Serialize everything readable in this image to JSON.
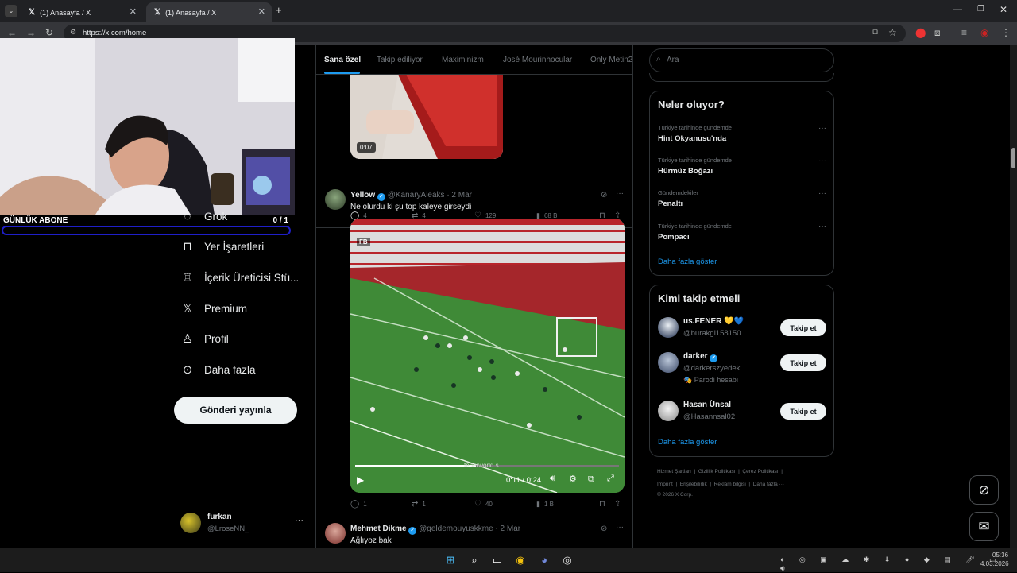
{
  "browser": {
    "tabs": [
      {
        "title": "(1) Anasayfa / X"
      },
      {
        "title": "(1) Anasayfa / X"
      }
    ],
    "url": "https://x.com/home"
  },
  "overlay": {
    "label": "GÜNLÜK ABONE",
    "count": "0 / 1"
  },
  "nav": {
    "items": [
      {
        "label": "Grok",
        "icon": "grok-icon"
      },
      {
        "label": "Yer İşaretleri",
        "icon": "bookmark-icon"
      },
      {
        "label": "İçerik Üreticisi Stü...",
        "icon": "creator-studio-icon"
      },
      {
        "label": "Premium",
        "icon": "x-logo-icon"
      },
      {
        "label": "Profil",
        "icon": "person-icon"
      },
      {
        "label": "Daha fazla",
        "icon": "more-circle-icon"
      }
    ],
    "post_button": "Gönderi yayınla",
    "account": {
      "name": "furkan",
      "handle": "@LroseNN_"
    }
  },
  "feed": {
    "tabs": [
      {
        "label": "Sana özel",
        "active": true
      },
      {
        "label": "Takip ediliyor",
        "active": false
      },
      {
        "label": "Maximinizm",
        "active": false
      },
      {
        "label": "José Mourinhocular",
        "active": false
      },
      {
        "label": "Only Metin2",
        "active": false
      }
    ],
    "tweet1": {
      "video_time": "0:07",
      "replies": "4",
      "reposts": "4",
      "likes": "129",
      "views": "68 B"
    },
    "tweet2": {
      "name": "Yellow",
      "handle": "@KanaryAleaks",
      "date": "· 2 Mar",
      "text": "Ne olurdu ki şu top kaleye girseydi",
      "video_badge": "FB",
      "watermark": "fenerworld.s",
      "video_time": "0:11 / 0:24",
      "replies": "1",
      "reposts": "1",
      "likes": "40",
      "views": "1 B"
    },
    "tweet3": {
      "name": "Mehmet Dikme",
      "handle": "@geldemouyuskkme",
      "date": "· 2 Mar",
      "text": "Ağlıyoz bak"
    }
  },
  "right": {
    "search_placeholder": "Ara",
    "trends_title": "Neler oluyor?",
    "trends": [
      {
        "context": "Türkiye tarihinde gündemde",
        "name": "Hint Okyanusu'nda"
      },
      {
        "context": "Türkiye tarihinde gündemde",
        "name": "Hürmüz Boğazı"
      },
      {
        "context": "Gündemdekiler",
        "name": "Penaltı"
      },
      {
        "context": "Türkiye tarihinde gündemde",
        "name": "Pompacı"
      }
    ],
    "show_more": "Daha fazla göster",
    "who_title": "Kimi takip etmeli",
    "who": [
      {
        "name": "us.FENER 💛💙",
        "handle": "@burakgl158150",
        "extra": ""
      },
      {
        "name": "darker",
        "handle": "@darkerszyedek",
        "extra": "🎭 Parodi hesabı"
      },
      {
        "name": "Hasan Ünsal",
        "handle": "@Hasannsal02",
        "extra": ""
      }
    ],
    "follow_label": "Takip et",
    "footer_line1": [
      "Hizmet Şartları",
      "Gizlilik Politikası",
      "Çerez Politikası"
    ],
    "footer_line2": [
      "Imprint",
      "Erişilebilirlik",
      "Reklam bilgisi",
      "Daha fazla ···"
    ],
    "copyright": "© 2026 X Corp."
  },
  "taskbar": {
    "time": "05:36",
    "date": "4.03.2026"
  }
}
